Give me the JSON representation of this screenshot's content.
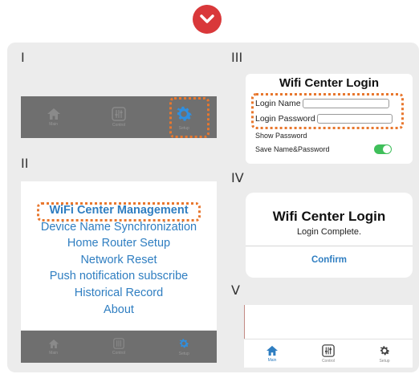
{
  "colors": {
    "accent_blue": "#2f7ec1",
    "badge_red": "#d9383a",
    "highlight_orange": "#e8772e",
    "toggle_green": "#3fbf5a",
    "tabbar_gray": "#6f6f6f"
  },
  "panel_labels": {
    "i": "I",
    "ii": "II",
    "iii": "III",
    "iv": "IV",
    "v": "V"
  },
  "tabs": {
    "main": "Main",
    "control": "Control",
    "setup": "Setup"
  },
  "screen_ii": {
    "menu": [
      "WiFi Center Management",
      "Device Name Synchronization",
      "Home Router Setup",
      "Network Reset",
      "Push notification subscribe",
      "Historical Record",
      "About"
    ]
  },
  "screen_iii": {
    "title": "Wifi Center Login",
    "login_name_label": "Login Name",
    "login_password_label": "Login Password",
    "show_password_label": "Show Password",
    "save_label": "Save Name&Password",
    "save_toggle_on": true
  },
  "screen_iv": {
    "title": "Wifi Center Login",
    "message": "Login Complete.",
    "confirm_label": "Confirm"
  },
  "icons": {
    "badge": "chevron-down-icon",
    "main": "home-icon",
    "control": "sliders-icon",
    "setup": "gear-icon"
  }
}
